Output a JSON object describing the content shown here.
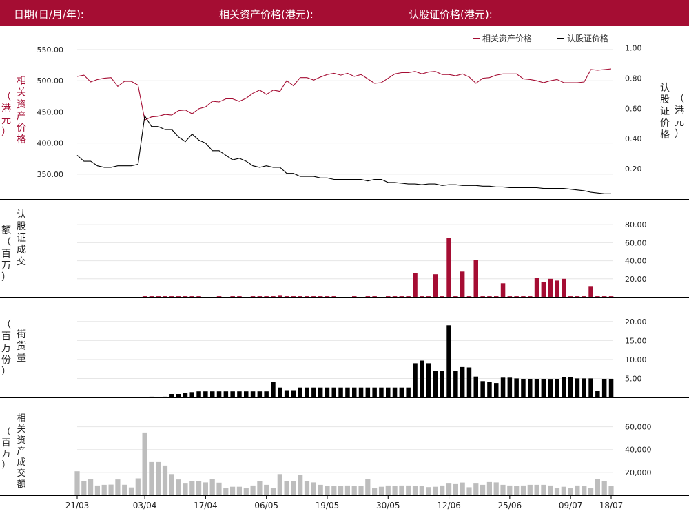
{
  "header": {
    "date_label": "日期(日/月/年):",
    "asset_price_label": "相关资产价格(港元):",
    "warrant_price_label": "认股证价格(港元):"
  },
  "colors": {
    "brand": "#a50d33",
    "warrant": "#000000",
    "turnover_bar": "#a50d33",
    "outstanding_bar": "#000000",
    "asset_turnover_bar": "#bdbdbd"
  },
  "chart_data": [
    {
      "type": "line",
      "legend": [
        "相关资产价格",
        "认股证价格"
      ],
      "legend_position": "top-right",
      "y_left_label": "相关资产价格（港元）",
      "y_right_label": "认股证价格（港元）",
      "y_left_ticks": [
        "550.00",
        "500.00",
        "450.00",
        "400.00",
        "350.00"
      ],
      "y_right_ticks": [
        "1.00",
        "0.80",
        "0.60",
        "0.40",
        "0.20"
      ],
      "y_left_range": [
        310,
        560
      ],
      "y_right_range": [
        0.0,
        1.03
      ],
      "series": [
        {
          "name": "相关资产价格",
          "axis": "left",
          "values": [
            507,
            509,
            498,
            502,
            504,
            505,
            491,
            499,
            499,
            493,
            437,
            442,
            443,
            446,
            445,
            452,
            453,
            447,
            455,
            458,
            467,
            466,
            471,
            471,
            467,
            472,
            480,
            485,
            478,
            485,
            483,
            500,
            492,
            505,
            505,
            501,
            506,
            510,
            512,
            509,
            512,
            507,
            510,
            503,
            496,
            497,
            504,
            511,
            513,
            513,
            515,
            511,
            514,
            515,
            510,
            510,
            508,
            511,
            506,
            496,
            504,
            505,
            509,
            511,
            511,
            511,
            503,
            502,
            500,
            497,
            500,
            502,
            497,
            497,
            497,
            498,
            518,
            517,
            518,
            519
          ]
        },
        {
          "name": "认股证价格",
          "axis": "right",
          "values": [
            0.29,
            0.25,
            0.25,
            0.22,
            0.21,
            0.21,
            0.22,
            0.22,
            0.22,
            0.23,
            0.55,
            0.48,
            0.48,
            0.46,
            0.46,
            0.41,
            0.38,
            0.43,
            0.39,
            0.37,
            0.32,
            0.32,
            0.29,
            0.26,
            0.27,
            0.25,
            0.22,
            0.21,
            0.22,
            0.21,
            0.21,
            0.17,
            0.17,
            0.15,
            0.15,
            0.15,
            0.14,
            0.14,
            0.13,
            0.13,
            0.13,
            0.13,
            0.13,
            0.12,
            0.13,
            0.13,
            0.11,
            0.11,
            0.105,
            0.1,
            0.1,
            0.095,
            0.1,
            0.1,
            0.09,
            0.095,
            0.095,
            0.09,
            0.09,
            0.09,
            0.085,
            0.085,
            0.08,
            0.08,
            0.075,
            0.075,
            0.075,
            0.075,
            0.075,
            0.07,
            0.07,
            0.07,
            0.07,
            0.065,
            0.06,
            0.055,
            0.045,
            0.04,
            0.035,
            0.035
          ]
        }
      ]
    },
    {
      "type": "bar",
      "y_label": "认股证成交额（百万）",
      "y_ticks": [
        "80.00",
        "60.00",
        "40.00",
        "20.00"
      ],
      "ylim": [
        0,
        87
      ],
      "values": [
        0,
        0,
        0,
        0,
        0,
        0,
        0,
        0,
        0,
        0,
        0.7,
        0.7,
        0.7,
        0.7,
        0.7,
        0.7,
        0.7,
        0.7,
        0.7,
        0,
        0,
        0.7,
        0,
        0.7,
        0.7,
        0,
        0.7,
        0.7,
        0.7,
        0.7,
        1.2,
        0.7,
        0.7,
        0.7,
        0.7,
        0.7,
        0.7,
        0.7,
        0.7,
        0,
        0,
        0.7,
        0,
        0.7,
        0.7,
        0,
        0.7,
        0.7,
        0.7,
        0.7,
        26,
        0.7,
        0.7,
        25,
        0.7,
        65,
        0.7,
        28,
        0.7,
        41,
        0.7,
        0.7,
        0.7,
        15,
        0.7,
        0.7,
        0.7,
        0.7,
        21,
        16,
        20,
        18,
        20,
        0.7,
        0.7,
        0.7,
        12,
        0.7,
        0.7,
        0.7
      ]
    },
    {
      "type": "bar",
      "y_label": "（百万份）街货量",
      "y_ticks": [
        "20.00",
        "15.00",
        "10.00",
        "5.00"
      ],
      "ylim": [
        0,
        20.5
      ],
      "values": [
        0,
        0,
        0,
        0,
        0,
        0,
        0,
        0,
        0,
        0,
        0,
        0.2,
        0,
        0.2,
        0.9,
        0.9,
        1.1,
        1.4,
        1.6,
        1.6,
        1.6,
        1.6,
        1.6,
        1.6,
        1.6,
        1.6,
        1.6,
        1.6,
        1.6,
        4.1,
        2.6,
        1.9,
        1.9,
        2.6,
        2.6,
        2.6,
        2.6,
        2.6,
        2.6,
        2.6,
        2.6,
        2.6,
        2.6,
        2.6,
        2.6,
        2.6,
        2.6,
        2.6,
        2.6,
        2.6,
        9.0,
        9.7,
        9.0,
        7.0,
        7.0,
        19.0,
        7.0,
        8.0,
        7.9,
        5.5,
        4.3,
        4.0,
        3.8,
        5.2,
        5.2,
        5.0,
        4.8,
        4.8,
        4.8,
        4.8,
        4.7,
        4.8,
        5.4,
        5.3,
        5.0,
        5.0,
        5.0,
        1.8,
        4.8,
        4.8
      ]
    },
    {
      "type": "bar",
      "y_label": "相关资产成交额（百万）",
      "y_ticks": [
        "60,000",
        "40,000",
        "20,000"
      ],
      "ylim": [
        0,
        70000
      ],
      "x_ticks": [
        "21/03",
        "03/04",
        "17/04",
        "06/05",
        "19/05",
        "30/05",
        "12/06",
        "25/06",
        "09/07",
        "18/07"
      ],
      "values": [
        21000,
        12500,
        14200,
        8500,
        9100,
        9300,
        13800,
        9200,
        6800,
        14800,
        55000,
        29000,
        29000,
        26000,
        18500,
        13800,
        10200,
        12100,
        12100,
        11200,
        14300,
        11000,
        6400,
        7400,
        7400,
        6400,
        8500,
        12100,
        9100,
        6400,
        18500,
        12100,
        12100,
        17500,
        12100,
        11200,
        9100,
        8100,
        8100,
        8100,
        8500,
        8100,
        8100,
        14300,
        6400,
        7400,
        8500,
        8100,
        8500,
        8500,
        8400,
        7900,
        7100,
        7400,
        8500,
        10200,
        9700,
        11100,
        7000,
        10200,
        9100,
        11500,
        11200,
        9100,
        8500,
        7900,
        8500,
        9100,
        9100,
        9100,
        8500,
        6400,
        7400,
        6400,
        8500,
        7900,
        6400,
        14300,
        12100,
        7900
      ]
    }
  ]
}
